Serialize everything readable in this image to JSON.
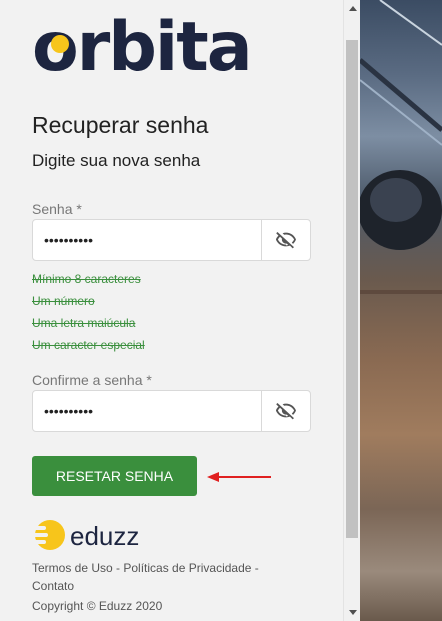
{
  "brand": {
    "logo_text": "orbita",
    "dot_color": "#f7c51b",
    "logo_color": "#1d2540"
  },
  "form": {
    "title": "Recuperar senha",
    "subtitle": "Digite sua nova senha",
    "password_label": "Senha *",
    "password_value": "••••••••••",
    "confirm_label": "Confirme a senha *",
    "confirm_value": "••••••••••",
    "rules": [
      "Mínimo 8 caracteres",
      "Um número",
      "Uma letra maiúcula",
      "Um caracter especial"
    ],
    "submit_label": "RESETAR SENHA",
    "accent_color": "#3a8f3d"
  },
  "footer": {
    "eduzz_text": "eduzz",
    "terms": "Termos de Uso",
    "privacy": "Políticas de Privacidade",
    "contact": "Contato",
    "copyright": "Copyright © Eduzz 2020"
  },
  "icons": {
    "toggle_visibility": "eye-off-icon",
    "annotation": "red-arrow-icon"
  }
}
